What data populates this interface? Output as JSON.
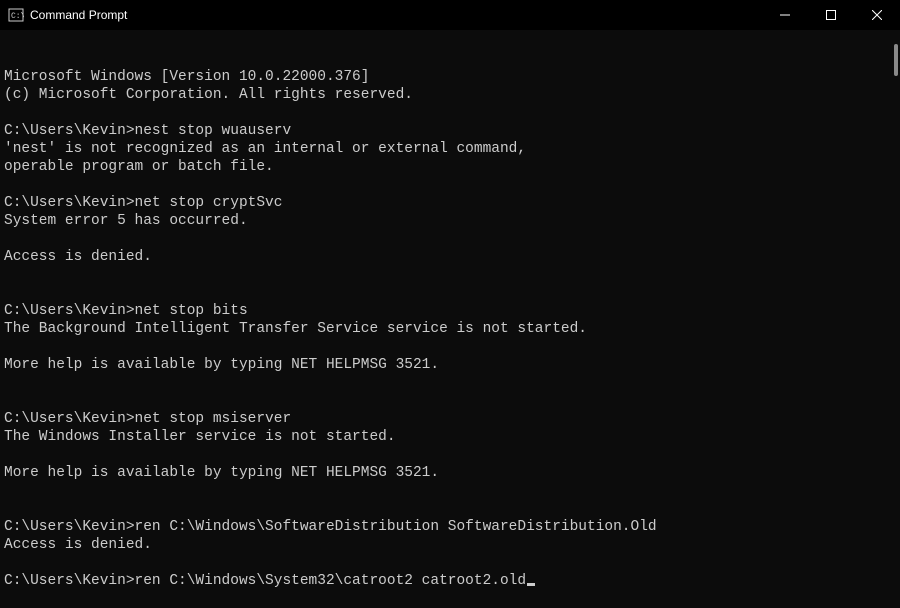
{
  "window": {
    "title": "Command Prompt"
  },
  "terminal": {
    "lines": [
      "Microsoft Windows [Version 10.0.22000.376]",
      "(c) Microsoft Corporation. All rights reserved.",
      "",
      "C:\\Users\\Kevin>nest stop wuauserv",
      "'nest' is not recognized as an internal or external command,",
      "operable program or batch file.",
      "",
      "C:\\Users\\Kevin>net stop cryptSvc",
      "System error 5 has occurred.",
      "",
      "Access is denied.",
      "",
      "",
      "C:\\Users\\Kevin>net stop bits",
      "The Background Intelligent Transfer Service service is not started.",
      "",
      "More help is available by typing NET HELPMSG 3521.",
      "",
      "",
      "C:\\Users\\Kevin>net stop msiserver",
      "The Windows Installer service is not started.",
      "",
      "More help is available by typing NET HELPMSG 3521.",
      "",
      "",
      "C:\\Users\\Kevin>ren C:\\Windows\\SoftwareDistribution SoftwareDistribution.Old",
      "Access is denied.",
      "",
      "C:\\Users\\Kevin>ren C:\\Windows\\System32\\catroot2 catroot2.old"
    ]
  }
}
